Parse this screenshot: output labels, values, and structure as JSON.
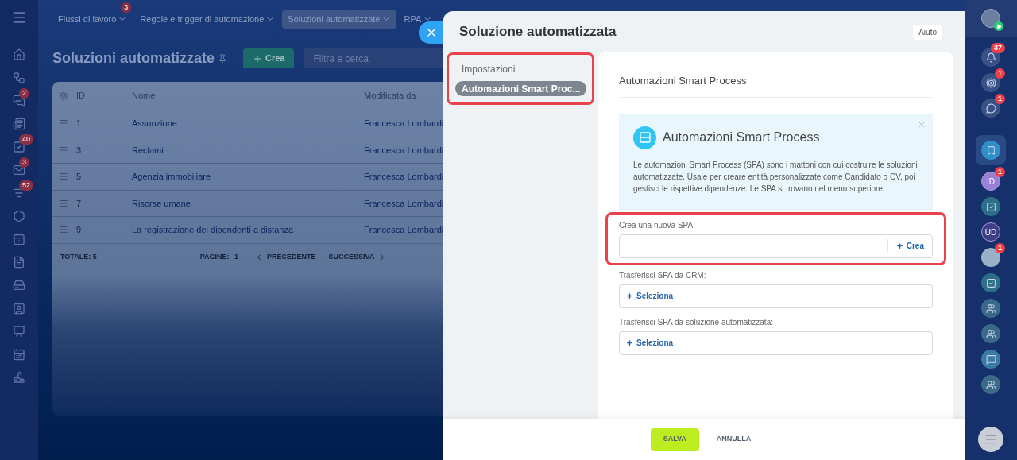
{
  "top_nav": {
    "tabs": [
      {
        "label": "Flussi di lavoro",
        "selected": false,
        "badge": "3"
      },
      {
        "label": "Regole e trigger di automazione",
        "selected": false
      },
      {
        "label": "Soluzioni automatizzate",
        "selected": true
      },
      {
        "label": "RPA",
        "selected": false
      }
    ]
  },
  "left_sidebar": {
    "items": [
      {
        "kind": "home"
      },
      {
        "kind": "automation"
      },
      {
        "kind": "chat",
        "badge": "2"
      },
      {
        "kind": "feed"
      },
      {
        "kind": "tasks",
        "badge": "40"
      },
      {
        "kind": "mail",
        "badge": "3"
      },
      {
        "kind": "filter",
        "badge": "52"
      },
      {
        "kind": "settings"
      },
      {
        "kind": "calendar"
      },
      {
        "kind": "document"
      },
      {
        "kind": "drive"
      },
      {
        "kind": "contacts"
      },
      {
        "kind": "board"
      },
      {
        "kind": "planner"
      },
      {
        "kind": "sign"
      }
    ]
  },
  "page": {
    "title": "Soluzioni automatizzate",
    "create_button": "Crea",
    "search": {
      "placeholder": "Filtra e cerca"
    }
  },
  "table": {
    "columns": [
      "ID",
      "Nome",
      "Modificata da"
    ],
    "rows": [
      {
        "id": "1",
        "name": "Assunzione",
        "modified_by": "Francesca Lombardi"
      },
      {
        "id": "3",
        "name": "Reclami",
        "modified_by": "Francesca Lombardi"
      },
      {
        "id": "5",
        "name": "Agenzia immobiliare",
        "modified_by": "Francesca Lombardi"
      },
      {
        "id": "7",
        "name": "Risorse umane",
        "modified_by": "Francesca Lombardi"
      },
      {
        "id": "9",
        "name": "La registrazione dei dipendenti a distanza",
        "modified_by": "Francesca Lombardi"
      }
    ],
    "footer": {
      "total_label": "TOTALE:",
      "total": "5",
      "pages_label": "PAGINE:",
      "page": "1",
      "prev": "PRECEDENTE",
      "next": "SUCCESSIVA"
    }
  },
  "panel": {
    "title": "Soluzione automatizzata",
    "help_button": "Aiuto",
    "menu": {
      "annotated": true,
      "items": [
        {
          "label": "Impostazioni",
          "selected": false
        },
        {
          "label": "Automazioni Smart Proc...",
          "selected": true
        }
      ]
    },
    "section_title": "Automazioni Smart Process",
    "info": {
      "title": "Automazioni Smart Process",
      "text": "Le automazioni Smart Process (SPA) sono i mattoni con cui costruire le soluzioni automatizzate. Usale per creare entità personalizzate come Candidato o CV, poi gestisci le rispettive dipendenze. Le SPA si trovano nel menu superiore."
    },
    "fields": [
      {
        "kind": "input",
        "label": "Crea una nuova SPA:",
        "action": "Crea",
        "annotated": true
      },
      {
        "kind": "select",
        "label": "Trasferisci SPA da CRM:",
        "action": "Seleziona",
        "annotated": false
      },
      {
        "kind": "select",
        "label": "Trasferisci SPA da soluzione automatizzata:",
        "action": "Seleziona",
        "annotated": false
      }
    ],
    "save_button": "SALVA",
    "cancel_button": "ANNULLA"
  },
  "right_sidebar": {
    "items": [
      {
        "kind": "bell",
        "badge": "37"
      },
      {
        "kind": "target",
        "badge": "1"
      },
      {
        "kind": "sync-chat",
        "badge": "1"
      },
      {
        "kind": "bookmark"
      },
      {
        "kind": "initials",
        "initials": "ID",
        "badge": "1"
      },
      {
        "kind": "task"
      },
      {
        "kind": "initials",
        "initials": "UD"
      },
      {
        "kind": "avatar",
        "badge": "1"
      },
      {
        "kind": "task"
      },
      {
        "kind": "group"
      },
      {
        "kind": "group"
      },
      {
        "kind": "chat"
      },
      {
        "kind": "group"
      }
    ]
  }
}
